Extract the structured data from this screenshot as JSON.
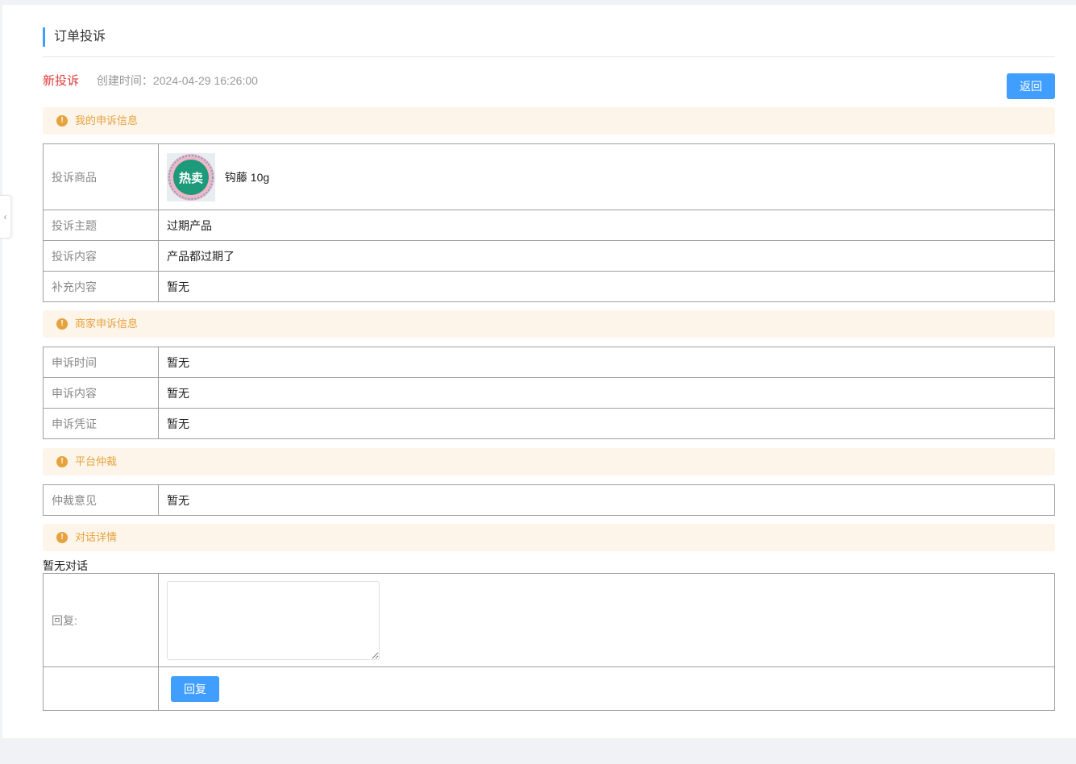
{
  "header": {
    "title": "订单投诉"
  },
  "complaint": {
    "status": "新投诉",
    "created_label": "创建时间：",
    "created_time": "2024-04-29 16:26:00",
    "back_label": "返回"
  },
  "colors": {
    "primary": "#409eff",
    "warning": "#e6a23c",
    "warning_bg": "#fdf5ea",
    "status_red": "#e23b3b"
  },
  "sections": {
    "my_appeal": {
      "title": "我的申诉信息",
      "product_label": "投诉商品",
      "product_image_text": "热卖",
      "product_name": "钩藤 10g",
      "rows": [
        {
          "label": "投诉主题",
          "value": "过期产品"
        },
        {
          "label": "投诉内容",
          "value": "产品都过期了"
        },
        {
          "label": "补充内容",
          "value": "暂无"
        }
      ]
    },
    "merchant_appeal": {
      "title": "商家申诉信息",
      "rows": [
        {
          "label": "申诉时间",
          "value": "暂无"
        },
        {
          "label": "申诉内容",
          "value": "暂无"
        },
        {
          "label": "申诉凭证",
          "value": "暂无"
        }
      ]
    },
    "arbitration": {
      "title": "平台仲裁",
      "rows": [
        {
          "label": "仲裁意见",
          "value": "暂无"
        }
      ]
    },
    "dialog": {
      "title": "对话详情",
      "empty_text": "暂无对话",
      "reply_label": "回复:",
      "reply_value": "",
      "reply_button": "回复"
    }
  },
  "icons": {
    "warning": "exclamation-circle-icon",
    "collapse": "chevron-left-icon"
  }
}
